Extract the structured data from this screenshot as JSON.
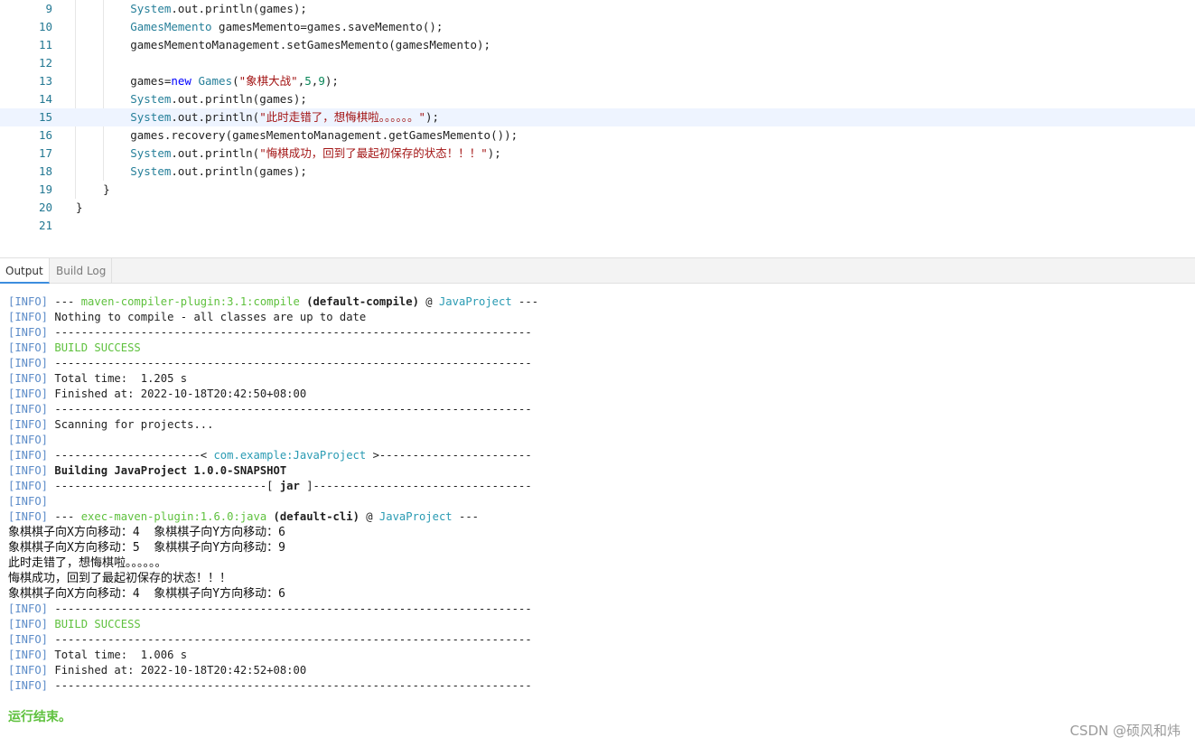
{
  "editor": {
    "lines": [
      {
        "num": "9",
        "parts": [
          [
            "k-teal",
            "System"
          ],
          [
            "",
            "."
          ],
          [
            "",
            "out"
          ],
          [
            "",
            "."
          ],
          [
            "",
            "println(games);"
          ]
        ],
        "indent": "        "
      },
      {
        "num": "10",
        "parts": [
          [
            "k-teal",
            "GamesMemento"
          ],
          [
            "",
            " gamesMemento=games.saveMemento();"
          ]
        ],
        "indent": "        "
      },
      {
        "num": "11",
        "parts": [
          [
            "",
            "gamesMementoManagement.setGamesMemento(gamesMemento);"
          ]
        ],
        "indent": "        "
      },
      {
        "num": "12",
        "parts": [],
        "indent": ""
      },
      {
        "num": "13",
        "parts": [
          [
            "",
            "games="
          ],
          [
            "k-blue",
            "new"
          ],
          [
            "",
            " "
          ],
          [
            "k-teal",
            "Games"
          ],
          [
            "",
            "("
          ],
          [
            "k-red",
            "\"象棋大战\""
          ],
          [
            "",
            ","
          ],
          [
            "k-green",
            "5"
          ],
          [
            "",
            ","
          ],
          [
            "k-green",
            "9"
          ],
          [
            "",
            ");"
          ]
        ],
        "indent": "        "
      },
      {
        "num": "14",
        "parts": [
          [
            "k-teal",
            "System"
          ],
          [
            "",
            ".out.println(games);"
          ]
        ],
        "indent": "        "
      },
      {
        "num": "15",
        "parts": [
          [
            "k-teal",
            "System"
          ],
          [
            "",
            ".out.println("
          ],
          [
            "k-red",
            "\"此时走错了，想悔棋啦。。。。。。\""
          ],
          [
            "",
            ");"
          ]
        ],
        "indent": "        ",
        "active": true
      },
      {
        "num": "16",
        "parts": [
          [
            "",
            "games.recovery(gamesMementoManagement.getGamesMemento());"
          ]
        ],
        "indent": "        "
      },
      {
        "num": "17",
        "parts": [
          [
            "k-teal",
            "System"
          ],
          [
            "",
            ".out.println("
          ],
          [
            "k-red",
            "\"悔棋成功，回到了最起初保存的状态！！！\""
          ],
          [
            "",
            ");"
          ]
        ],
        "indent": "        "
      },
      {
        "num": "18",
        "parts": [
          [
            "k-teal",
            "System"
          ],
          [
            "",
            ".out.println(games);"
          ]
        ],
        "indent": "        "
      },
      {
        "num": "19",
        "parts": [
          [
            "",
            "}"
          ]
        ],
        "indent": "    "
      },
      {
        "num": "20",
        "parts": [
          [
            "",
            "}"
          ]
        ],
        "indent": ""
      },
      {
        "num": "21",
        "parts": [],
        "indent": ""
      }
    ]
  },
  "tabs": [
    {
      "label": "Output",
      "active": true
    },
    {
      "label": "Build Log",
      "active": false
    }
  ],
  "output": {
    "lines": [
      [
        [
          "info",
          "[INFO]"
        ],
        [
          "",
          " --- "
        ],
        [
          "green",
          "maven-compiler-plugin:3.1:compile"
        ],
        [
          "",
          " "
        ],
        [
          "bold",
          "(default-compile)"
        ],
        [
          "",
          " @ "
        ],
        [
          "teal",
          "JavaProject"
        ],
        [
          "",
          " ---"
        ]
      ],
      [
        [
          "info",
          "[INFO]"
        ],
        [
          "",
          " Nothing to compile - all classes are up to date"
        ]
      ],
      [
        [
          "info",
          "[INFO]"
        ],
        [
          "",
          " ------------------------------------------------------------------------"
        ]
      ],
      [
        [
          "info",
          "[INFO]"
        ],
        [
          "",
          " "
        ],
        [
          "green",
          "BUILD SUCCESS"
        ]
      ],
      [
        [
          "info",
          "[INFO]"
        ],
        [
          "",
          " ------------------------------------------------------------------------"
        ]
      ],
      [
        [
          "info",
          "[INFO]"
        ],
        [
          "",
          " Total time:  1.205 s"
        ]
      ],
      [
        [
          "info",
          "[INFO]"
        ],
        [
          "",
          " Finished at: 2022-10-18T20:42:50+08:00"
        ]
      ],
      [
        [
          "info",
          "[INFO]"
        ],
        [
          "",
          " ------------------------------------------------------------------------"
        ]
      ],
      [
        [
          "info",
          "[INFO]"
        ],
        [
          "",
          " Scanning for projects..."
        ]
      ],
      [
        [
          "info",
          "[INFO]"
        ]
      ],
      [
        [
          "info",
          "[INFO]"
        ],
        [
          "",
          " ----------------------< "
        ],
        [
          "teal",
          "com.example:JavaProject"
        ],
        [
          "",
          " >-----------------------"
        ]
      ],
      [
        [
          "info",
          "[INFO]"
        ],
        [
          "",
          " "
        ],
        [
          "bold",
          "Building JavaProject 1.0.0-SNAPSHOT"
        ]
      ],
      [
        [
          "info",
          "[INFO]"
        ],
        [
          "",
          " --------------------------------[ "
        ],
        [
          "bold",
          "jar"
        ],
        [
          "",
          " ]---------------------------------"
        ]
      ],
      [
        [
          "info",
          "[INFO]"
        ]
      ],
      [
        [
          "info",
          "[INFO]"
        ],
        [
          "",
          " --- "
        ],
        [
          "green",
          "exec-maven-plugin:1.6.0:java"
        ],
        [
          "",
          " "
        ],
        [
          "bold",
          "(default-cli)"
        ],
        [
          "",
          " @ "
        ],
        [
          "teal",
          "JavaProject"
        ],
        [
          "",
          " ---"
        ]
      ],
      [
        [
          "zh",
          "象棋棋子向X方向移动：4  象棋棋子向Y方向移动：6"
        ]
      ],
      [
        [
          "zh",
          "象棋棋子向X方向移动：5  象棋棋子向Y方向移动：9"
        ]
      ],
      [
        [
          "zh",
          "此时走错了，想悔棋啦。。。。。。"
        ]
      ],
      [
        [
          "zh",
          "悔棋成功，回到了最起初保存的状态！！！"
        ]
      ],
      [
        [
          "zh",
          "象棋棋子向X方向移动：4  象棋棋子向Y方向移动：6"
        ]
      ],
      [
        [
          "info",
          "[INFO]"
        ],
        [
          "",
          " ------------------------------------------------------------------------"
        ]
      ],
      [
        [
          "info",
          "[INFO]"
        ],
        [
          "",
          " "
        ],
        [
          "green",
          "BUILD SUCCESS"
        ]
      ],
      [
        [
          "info",
          "[INFO]"
        ],
        [
          "",
          " ------------------------------------------------------------------------"
        ]
      ],
      [
        [
          "info",
          "[INFO]"
        ],
        [
          "",
          " Total time:  1.006 s"
        ]
      ],
      [
        [
          "info",
          "[INFO]"
        ],
        [
          "",
          " Finished at: 2022-10-18T20:42:52+08:00"
        ]
      ],
      [
        [
          "info",
          "[INFO]"
        ],
        [
          "",
          " ------------------------------------------------------------------------"
        ]
      ]
    ],
    "run_end": "运行结束。"
  },
  "watermark": "CSDN @硕风和炜"
}
